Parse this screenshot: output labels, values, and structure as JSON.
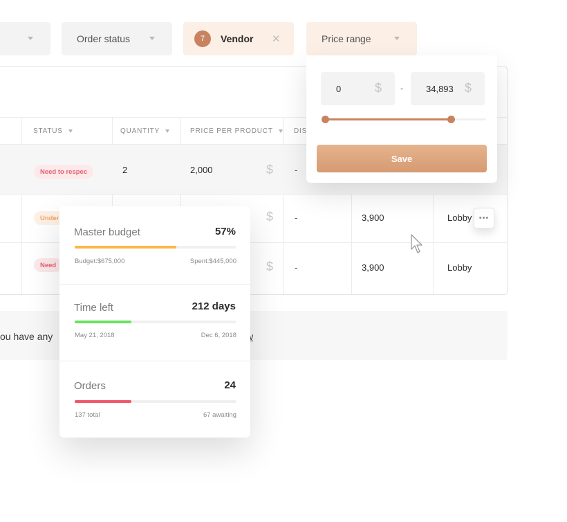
{
  "filters": {
    "order_status": "Order status",
    "vendor": {
      "count": "7",
      "label": "Vendor"
    },
    "price_range": "Price range"
  },
  "table": {
    "headers": {
      "status": "STATUS",
      "quantity": "QUANTITY",
      "price": "PRICE PER PRODUCT",
      "discount_partial": "DISC"
    },
    "rows": [
      {
        "status": "Need to respec",
        "quantity": "2",
        "price": "2,000",
        "discount": "-",
        "total": "",
        "location": ""
      },
      {
        "status": "Under",
        "discount": "-",
        "total": "3,900",
        "location": "Lobby"
      },
      {
        "status": "Need",
        "discount": "-",
        "total": "3,900",
        "location": "Lobby"
      }
    ],
    "currency_symbol": "$"
  },
  "banner": {
    "text": "ou have any",
    "link": "w"
  },
  "price_filter": {
    "min": "0",
    "max": "34,893",
    "separator": "-",
    "currency": "$",
    "slider_low_fraction": 0.0,
    "slider_high_fraction": 0.78,
    "save_label": "Save",
    "accent_color": "#c7835f"
  },
  "budget_card": {
    "master": {
      "title": "Master budget",
      "percent": "57%",
      "progress": 0.63,
      "left_label": "Budget:$675,000",
      "right_label": "Spent:$445,000",
      "color": "#fbb74a"
    },
    "time": {
      "title": "Time left",
      "value": "212 days",
      "progress": 0.35,
      "left_label": "May 21, 2018",
      "right_label": "Dec 6, 2018",
      "color": "#6be15f"
    },
    "orders": {
      "title": "Orders",
      "value": "24",
      "progress": 0.35,
      "left_label": "137 total",
      "right_label": "67 awaiting",
      "color": "#f2566a"
    }
  },
  "icons": {
    "more": "more-horizontal-icon",
    "close": "close-icon",
    "caret": "caret-down-icon",
    "cursor": "mouse-pointer-icon"
  }
}
